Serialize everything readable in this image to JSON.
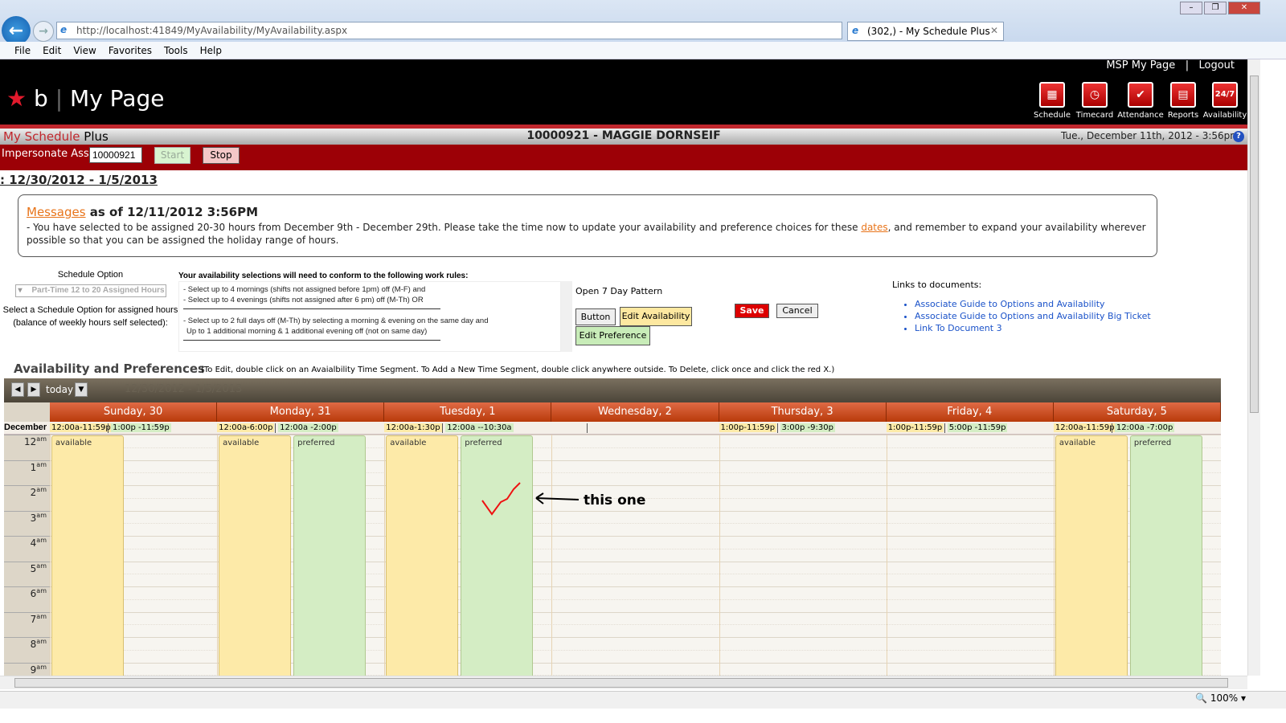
{
  "browser": {
    "url": "http://localhost:41849/MyAvailability/MyAvailability.aspx",
    "tab_title": "(302,) - My Schedule Plus",
    "menu": [
      "File",
      "Edit",
      "View",
      "Favorites",
      "Tools",
      "Help"
    ],
    "zoom": "100%"
  },
  "header": {
    "logo_text": "b",
    "title": "My Page",
    "links": [
      "MSP My Page",
      "|",
      "Logout"
    ],
    "nav": [
      {
        "label": "Schedule",
        "icon": "calendar-icon",
        "glyph": "▦"
      },
      {
        "label": "Timecard",
        "icon": "clock-icon",
        "glyph": "◷"
      },
      {
        "label": "Attendance",
        "icon": "checkmark-icon",
        "glyph": "✔"
      },
      {
        "label": "Reports",
        "icon": "report-icon",
        "glyph": "▤"
      },
      {
        "label": "Availability",
        "icon": "24-7-icon",
        "glyph": "24/7"
      }
    ]
  },
  "subheader": {
    "brand_red": "My Schedule",
    "brand_plain": "Plus",
    "associate": "10000921 - MAGGIE DORNSEIF",
    "datetime": "Tue., December 11th, 2012 - 3:56pm",
    "help": "?"
  },
  "impersonate": {
    "label": "Impersonate Assoc:",
    "value": "10000921",
    "start": "Start",
    "stop": "Stop"
  },
  "week_range": ": 12/30/2012 - 1/5/2013",
  "messages": {
    "link": "Messages",
    "title_rest": " as of 12/11/2012 3:56PM",
    "body_1": "- You have selected to be assigned 20-30 hours from December 9th - December 29th. Please take the time now to update your availability and preference choices for these ",
    "dates_link": "dates",
    "body_2": ", and remember to expand your availability wherever possible so that you can be assigned the holiday range of hours."
  },
  "schedule_option": {
    "heading": "Schedule Option",
    "selected": "Part-Time 12 to 20 Assigned Hours",
    "help_1": "Select a Schedule Option for assigned hours",
    "help_2": "(balance of weekly hours self selected):"
  },
  "rules": {
    "heading": "Your availability selections will need to conform to the following work rules:",
    "lines": [
      "- Select up to 4 mornings (shifts not assigned before 1pm) off (M-F) and",
      "- Select up to 4 evenings (shifts not assigned after 6 pm) off (M-Th) OR",
      "- Select up to 2 full days off (M-Th) by selecting a morning & evening on the same day and",
      "  Up to 1 additional morning & 1 additional evening off (not on same day)"
    ]
  },
  "actions": {
    "pattern": "Open 7 Day Pattern",
    "button": "Button",
    "edit_availability": "Edit Availability",
    "edit_preference": "Edit Preference",
    "save": "Save",
    "cancel": "Cancel"
  },
  "documents": {
    "heading": "Links to documents:",
    "links": [
      "Associate Guide to Options and Availability",
      "Associate Guide to Options and Availability Big Ticket",
      "Link To Document 3"
    ]
  },
  "availability": {
    "heading": "Availability and Preferences",
    "note": "(To Edit, double click on an Avaialbility Time Segment. To Add a New Time Segment, double click anywhere outside. To Delete, click once and click the red X.)"
  },
  "calendar": {
    "today": "today",
    "range_faded": "12/30/2012 - 1/5/2013",
    "month": "December",
    "hours": [
      "12",
      "1",
      "2",
      "3",
      "4",
      "5",
      "6",
      "7",
      "8",
      "9"
    ],
    "ampm": "am",
    "days": [
      {
        "label": "Sunday, 30",
        "avail": "12:00a-11:59p",
        "pref": "1:00p -11:59p",
        "events": [
          {
            "type": "available",
            "start": 0,
            "end": 24
          }
        ]
      },
      {
        "label": "Monday, 31",
        "avail": "12:00a-6:00p",
        "pref": "12:00a -2:00p",
        "events": [
          {
            "type": "available",
            "start": 0,
            "end": 18
          },
          {
            "type": "preferred",
            "start": 0,
            "end": 14
          }
        ]
      },
      {
        "label": "Tuesday, 1",
        "avail": "12:00a-1:30p",
        "pref": "12:00a --10:30a",
        "events": [
          {
            "type": "available",
            "start": 0,
            "end": 13.5
          },
          {
            "type": "preferred",
            "start": 0,
            "end": 10.5
          }
        ]
      },
      {
        "label": "Wednesday, 2",
        "avail": "",
        "pref": "",
        "events": []
      },
      {
        "label": "Thursday, 3",
        "avail": "1:00p-11:59p",
        "pref": "3:00p -9:30p",
        "events": []
      },
      {
        "label": "Friday, 4",
        "avail": "1:00p-11:59p",
        "pref": "5:00p -11:59p",
        "events": []
      },
      {
        "label": "Saturday, 5",
        "avail": "12:00a-11:59p",
        "pref": "12:00a -7:00p",
        "events": [
          {
            "type": "available",
            "start": 0,
            "end": 24
          },
          {
            "type": "preferred",
            "start": 0,
            "end": 19
          }
        ]
      }
    ],
    "labels": {
      "available": "available",
      "preferred": "preferred"
    }
  },
  "annotation": {
    "text": "this one"
  },
  "colors": {
    "brand_red": "#9c0006",
    "available": "#fdeaa8",
    "preferred": "#d4edc4",
    "day_header": "#c8461a"
  }
}
